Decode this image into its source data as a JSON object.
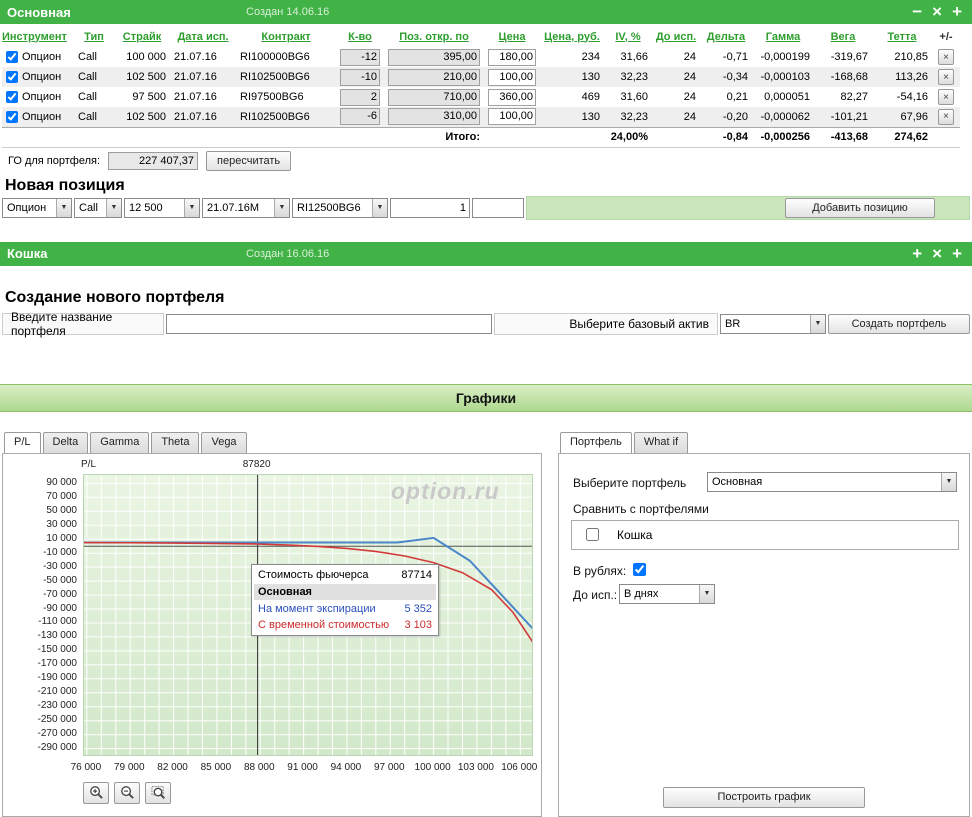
{
  "portfolio_panel": {
    "title": "Основная",
    "created": "Создан 14.06.16",
    "window_buttons": [
      "−",
      "×",
      "+"
    ],
    "table": {
      "headers": [
        "Инструмент",
        "Тип",
        "Страйк",
        "Дата исп.",
        "Контракт",
        "К-во",
        "Поз. откр. по",
        "Цена",
        "Цена, руб.",
        "IV, %",
        "До исп.",
        "Дельта",
        "Гамма",
        "Вега",
        "Тетта",
        "+/-"
      ],
      "rows": [
        {
          "checked": true,
          "instrument": "Опцион",
          "type": "Call",
          "strike": "100 000",
          "exp_date": "21.07.16",
          "contract": "RI100000BG6",
          "qty": "-12",
          "open_pos": "395,00",
          "price": "180,00",
          "price_rub": "234",
          "iv": "31,66",
          "days": "24",
          "delta": "-0,71",
          "gamma": "-0,000199",
          "vega": "-319,67",
          "theta": "210,85"
        },
        {
          "checked": true,
          "instrument": "Опцион",
          "type": "Call",
          "strike": "102 500",
          "exp_date": "21.07.16",
          "contract": "RI102500BG6",
          "qty": "-10",
          "open_pos": "210,00",
          "price": "100,00",
          "price_rub": "130",
          "iv": "32,23",
          "days": "24",
          "delta": "-0,34",
          "gamma": "-0,000103",
          "vega": "-168,68",
          "theta": "113,26"
        },
        {
          "checked": true,
          "instrument": "Опцион",
          "type": "Call",
          "strike": "97 500",
          "exp_date": "21.07.16",
          "contract": "RI97500BG6",
          "qty": "2",
          "open_pos": "710,00",
          "price": "360,00",
          "price_rub": "469",
          "iv": "31,60",
          "days": "24",
          "delta": "0,21",
          "gamma": "0,000051",
          "vega": "82,27",
          "theta": "-54,16"
        },
        {
          "checked": true,
          "instrument": "Опцион",
          "type": "Call",
          "strike": "102 500",
          "exp_date": "21.07.16",
          "contract": "RI102500BG6",
          "qty": "-6",
          "open_pos": "310,00",
          "price": "100,00",
          "price_rub": "130",
          "iv": "32,23",
          "days": "24",
          "delta": "-0,20",
          "gamma": "-0,000062",
          "vega": "-101,21",
          "theta": "67,96"
        }
      ],
      "totals": {
        "label": "Итого:",
        "iv_total": "24,00%",
        "delta": "-0,84",
        "gamma": "-0,000256",
        "vega": "-413,68",
        "theta": "274,62"
      },
      "delete_button": "×"
    },
    "margin": {
      "label": "ГО для портфеля:",
      "value": "227 407,37",
      "recalc_button": "пересчитать"
    },
    "new_position": {
      "heading": "Новая позиция",
      "instrument": "Опцион",
      "option_type": "Call",
      "strike": "12 500",
      "date": "21.07.16М",
      "contract": "RI12500BG6",
      "quantity": "1",
      "price": "",
      "add_button": "Добавить позицию"
    }
  },
  "cat_panel": {
    "title": "Кошка",
    "created": "Создан 16.06.16",
    "window_buttons": [
      "+",
      "×",
      "+"
    ]
  },
  "new_portfolio": {
    "heading": "Создание нового портфеля",
    "name_label": "Введите название портфеля",
    "asset_label": "Выберите базовый актив",
    "asset_value": "BR",
    "create_button": "Создать портфель"
  },
  "charts": {
    "heading": "Графики",
    "tabs": [
      "P/L",
      "Delta",
      "Gamma",
      "Theta",
      "Vega"
    ],
    "active_tab": "P/L",
    "y_axis_label": "P/L",
    "current_price_label": "87820",
    "watermark": "option.ru",
    "tooltip": {
      "futures_label": "Стоимость фьючерса",
      "futures_value": "87714",
      "portfolio": "Основная",
      "expiry_label": "На момент экспирации",
      "expiry_value": "5 352",
      "time_label": "С временной стоимостью",
      "time_value": "3 103"
    }
  },
  "chart_data": {
    "type": "line",
    "title": "P/L",
    "xlabel": "",
    "ylabel": "P/L",
    "xlim": [
      75800,
      106950
    ],
    "ylim": [
      -302000,
      102000
    ],
    "grid_x_start": 76000,
    "grid_x_end": 106000,
    "grid_x_step": 1000,
    "current_price": 87820,
    "x_ticks": [
      "76 000",
      "79 000",
      "82 000",
      "85 000",
      "88 000",
      "91 000",
      "94 000",
      "97 000",
      "100 000",
      "103 000",
      "106 000"
    ],
    "x_tick_values": [
      76000,
      79000,
      82000,
      85000,
      88000,
      91000,
      94000,
      97000,
      100000,
      103000,
      106000
    ],
    "y_ticks": [
      "90 000",
      "70 000",
      "50 000",
      "30 000",
      "10 000",
      "-10 000",
      "-30 000",
      "-50 000",
      "-70 000",
      "-90 000",
      "-110 000",
      "-130 000",
      "-150 000",
      "-170 000",
      "-190 000",
      "-210 000",
      "-230 000",
      "-250 000",
      "-270 000",
      "-290 000"
    ],
    "y_tick_values": [
      90000,
      70000,
      50000,
      30000,
      10000,
      -10000,
      -30000,
      -50000,
      -70000,
      -90000,
      -110000,
      -130000,
      -150000,
      -170000,
      -190000,
      -210000,
      -230000,
      -250000,
      -270000,
      -290000
    ],
    "series": [
      {
        "name": "На момент экспирации",
        "color": "#4a86c8",
        "x": [
          75800,
          97500,
          100000,
          102500,
          104000,
          106950
        ],
        "y": [
          5352,
          5352,
          11852,
          -20600,
          -54000,
          -120000
        ]
      },
      {
        "name": "С временной стоимостью",
        "color": "#d23a3a",
        "x": [
          75800,
          80000,
          84000,
          87714,
          90000,
          92000,
          94000,
          96000,
          98000,
          100000,
          102000,
          104000,
          105500,
          106950
        ],
        "y": [
          5200,
          4900,
          4200,
          3103,
          1600,
          -300,
          -3200,
          -7500,
          -14000,
          -23500,
          -38000,
          -62000,
          -95000,
          -140000
        ]
      }
    ]
  },
  "right_panel": {
    "tabs": [
      "Портфель",
      "What if"
    ],
    "active_tab": "Портфель",
    "select_portfolio_label": "Выберите портфель",
    "selected_portfolio": "Основная",
    "compare_label": "Сравнить с портфелями",
    "compare_items": [
      {
        "label": "Кошка",
        "checked": false
      }
    ],
    "rub_label": "В рублях:",
    "rub_checked": true,
    "days_label": "До исп.:",
    "days_value": "В днях",
    "build_button": "Построить график"
  }
}
